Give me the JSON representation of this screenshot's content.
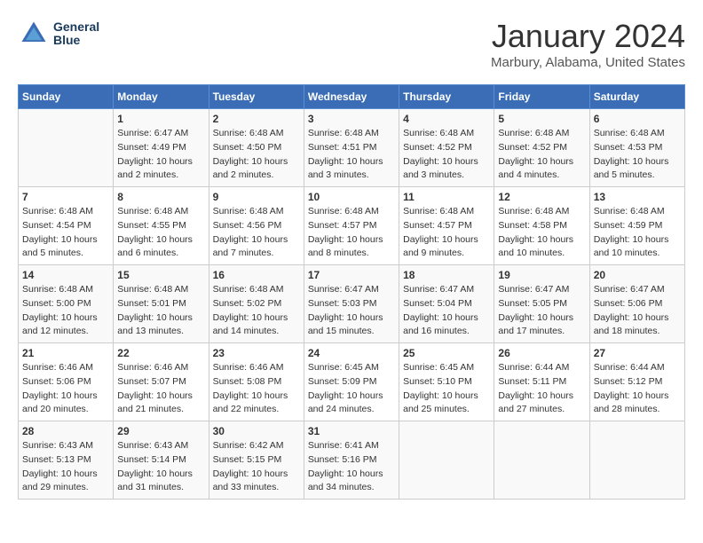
{
  "logo": {
    "line1": "General",
    "line2": "Blue"
  },
  "title": "January 2024",
  "subtitle": "Marbury, Alabama, United States",
  "days_of_week": [
    "Sunday",
    "Monday",
    "Tuesday",
    "Wednesday",
    "Thursday",
    "Friday",
    "Saturday"
  ],
  "weeks": [
    [
      {
        "day": "",
        "sunrise": "",
        "sunset": "",
        "daylight": ""
      },
      {
        "day": "1",
        "sunrise": "Sunrise: 6:47 AM",
        "sunset": "Sunset: 4:49 PM",
        "daylight": "Daylight: 10 hours and 2 minutes."
      },
      {
        "day": "2",
        "sunrise": "Sunrise: 6:48 AM",
        "sunset": "Sunset: 4:50 PM",
        "daylight": "Daylight: 10 hours and 2 minutes."
      },
      {
        "day": "3",
        "sunrise": "Sunrise: 6:48 AM",
        "sunset": "Sunset: 4:51 PM",
        "daylight": "Daylight: 10 hours and 3 minutes."
      },
      {
        "day": "4",
        "sunrise": "Sunrise: 6:48 AM",
        "sunset": "Sunset: 4:52 PM",
        "daylight": "Daylight: 10 hours and 3 minutes."
      },
      {
        "day": "5",
        "sunrise": "Sunrise: 6:48 AM",
        "sunset": "Sunset: 4:52 PM",
        "daylight": "Daylight: 10 hours and 4 minutes."
      },
      {
        "day": "6",
        "sunrise": "Sunrise: 6:48 AM",
        "sunset": "Sunset: 4:53 PM",
        "daylight": "Daylight: 10 hours and 5 minutes."
      }
    ],
    [
      {
        "day": "7",
        "sunrise": "Sunrise: 6:48 AM",
        "sunset": "Sunset: 4:54 PM",
        "daylight": "Daylight: 10 hours and 5 minutes."
      },
      {
        "day": "8",
        "sunrise": "Sunrise: 6:48 AM",
        "sunset": "Sunset: 4:55 PM",
        "daylight": "Daylight: 10 hours and 6 minutes."
      },
      {
        "day": "9",
        "sunrise": "Sunrise: 6:48 AM",
        "sunset": "Sunset: 4:56 PM",
        "daylight": "Daylight: 10 hours and 7 minutes."
      },
      {
        "day": "10",
        "sunrise": "Sunrise: 6:48 AM",
        "sunset": "Sunset: 4:57 PM",
        "daylight": "Daylight: 10 hours and 8 minutes."
      },
      {
        "day": "11",
        "sunrise": "Sunrise: 6:48 AM",
        "sunset": "Sunset: 4:57 PM",
        "daylight": "Daylight: 10 hours and 9 minutes."
      },
      {
        "day": "12",
        "sunrise": "Sunrise: 6:48 AM",
        "sunset": "Sunset: 4:58 PM",
        "daylight": "Daylight: 10 hours and 10 minutes."
      },
      {
        "day": "13",
        "sunrise": "Sunrise: 6:48 AM",
        "sunset": "Sunset: 4:59 PM",
        "daylight": "Daylight: 10 hours and 10 minutes."
      }
    ],
    [
      {
        "day": "14",
        "sunrise": "Sunrise: 6:48 AM",
        "sunset": "Sunset: 5:00 PM",
        "daylight": "Daylight: 10 hours and 12 minutes."
      },
      {
        "day": "15",
        "sunrise": "Sunrise: 6:48 AM",
        "sunset": "Sunset: 5:01 PM",
        "daylight": "Daylight: 10 hours and 13 minutes."
      },
      {
        "day": "16",
        "sunrise": "Sunrise: 6:48 AM",
        "sunset": "Sunset: 5:02 PM",
        "daylight": "Daylight: 10 hours and 14 minutes."
      },
      {
        "day": "17",
        "sunrise": "Sunrise: 6:47 AM",
        "sunset": "Sunset: 5:03 PM",
        "daylight": "Daylight: 10 hours and 15 minutes."
      },
      {
        "day": "18",
        "sunrise": "Sunrise: 6:47 AM",
        "sunset": "Sunset: 5:04 PM",
        "daylight": "Daylight: 10 hours and 16 minutes."
      },
      {
        "day": "19",
        "sunrise": "Sunrise: 6:47 AM",
        "sunset": "Sunset: 5:05 PM",
        "daylight": "Daylight: 10 hours and 17 minutes."
      },
      {
        "day": "20",
        "sunrise": "Sunrise: 6:47 AM",
        "sunset": "Sunset: 5:06 PM",
        "daylight": "Daylight: 10 hours and 18 minutes."
      }
    ],
    [
      {
        "day": "21",
        "sunrise": "Sunrise: 6:46 AM",
        "sunset": "Sunset: 5:06 PM",
        "daylight": "Daylight: 10 hours and 20 minutes."
      },
      {
        "day": "22",
        "sunrise": "Sunrise: 6:46 AM",
        "sunset": "Sunset: 5:07 PM",
        "daylight": "Daylight: 10 hours and 21 minutes."
      },
      {
        "day": "23",
        "sunrise": "Sunrise: 6:46 AM",
        "sunset": "Sunset: 5:08 PM",
        "daylight": "Daylight: 10 hours and 22 minutes."
      },
      {
        "day": "24",
        "sunrise": "Sunrise: 6:45 AM",
        "sunset": "Sunset: 5:09 PM",
        "daylight": "Daylight: 10 hours and 24 minutes."
      },
      {
        "day": "25",
        "sunrise": "Sunrise: 6:45 AM",
        "sunset": "Sunset: 5:10 PM",
        "daylight": "Daylight: 10 hours and 25 minutes."
      },
      {
        "day": "26",
        "sunrise": "Sunrise: 6:44 AM",
        "sunset": "Sunset: 5:11 PM",
        "daylight": "Daylight: 10 hours and 27 minutes."
      },
      {
        "day": "27",
        "sunrise": "Sunrise: 6:44 AM",
        "sunset": "Sunset: 5:12 PM",
        "daylight": "Daylight: 10 hours and 28 minutes."
      }
    ],
    [
      {
        "day": "28",
        "sunrise": "Sunrise: 6:43 AM",
        "sunset": "Sunset: 5:13 PM",
        "daylight": "Daylight: 10 hours and 29 minutes."
      },
      {
        "day": "29",
        "sunrise": "Sunrise: 6:43 AM",
        "sunset": "Sunset: 5:14 PM",
        "daylight": "Daylight: 10 hours and 31 minutes."
      },
      {
        "day": "30",
        "sunrise": "Sunrise: 6:42 AM",
        "sunset": "Sunset: 5:15 PM",
        "daylight": "Daylight: 10 hours and 33 minutes."
      },
      {
        "day": "31",
        "sunrise": "Sunrise: 6:41 AM",
        "sunset": "Sunset: 5:16 PM",
        "daylight": "Daylight: 10 hours and 34 minutes."
      },
      {
        "day": "",
        "sunrise": "",
        "sunset": "",
        "daylight": ""
      },
      {
        "day": "",
        "sunrise": "",
        "sunset": "",
        "daylight": ""
      },
      {
        "day": "",
        "sunrise": "",
        "sunset": "",
        "daylight": ""
      }
    ]
  ]
}
